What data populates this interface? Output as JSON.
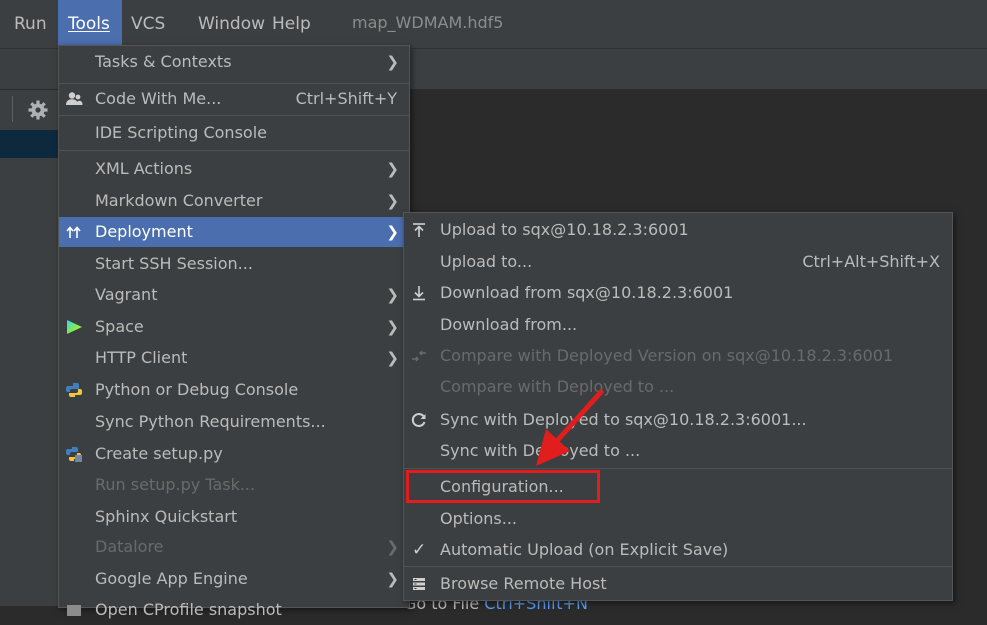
{
  "menubar": {
    "items": [
      {
        "label": "Run",
        "underline": ""
      },
      {
        "label": "Tools",
        "active": true
      },
      {
        "label": "VCS"
      },
      {
        "label": "Window"
      },
      {
        "label": "Help"
      }
    ],
    "file_title": "map_WDMAM.hdf5"
  },
  "tools_menu": {
    "items": [
      {
        "label": "Tasks & Contexts",
        "submenu": true
      },
      {
        "label": "Code With Me...",
        "shortcut": "Ctrl+Shift+Y",
        "icon": "code-with-me-icon"
      },
      {
        "label": "IDE Scripting Console"
      },
      {
        "label": "XML Actions",
        "submenu": true
      },
      {
        "label": "Markdown Converter",
        "submenu": true
      },
      {
        "label": "Deployment",
        "submenu": true,
        "icon": "deployment-icon",
        "highlighted": true
      },
      {
        "label": "Start SSH Session..."
      },
      {
        "label": "Vagrant",
        "submenu": true
      },
      {
        "label": "Space",
        "submenu": true,
        "icon": "space-icon"
      },
      {
        "label": "HTTP Client",
        "submenu": true
      },
      {
        "label": "Python or Debug Console",
        "icon": "python-icon"
      },
      {
        "label": "Sync Python Requirements..."
      },
      {
        "label": "Create setup.py",
        "icon": "python-setup-icon"
      },
      {
        "label": "Run setup.py Task...",
        "disabled": true
      },
      {
        "label": "Sphinx Quickstart"
      },
      {
        "label": "Datalore",
        "disabled": true,
        "submenu": true
      },
      {
        "label": "Google App Engine",
        "submenu": true
      },
      {
        "label": "Open CProfile snapshot"
      }
    ]
  },
  "deployment_menu": {
    "items": [
      {
        "label": "Upload to sqx@10.18.2.3:6001",
        "icon": "upload-icon"
      },
      {
        "label": "Upload to...",
        "shortcut": "Ctrl+Alt+Shift+X"
      },
      {
        "label": "Download from sqx@10.18.2.3:6001",
        "icon": "download-icon"
      },
      {
        "label": "Download from..."
      },
      {
        "label": "Compare with Deployed Version on sqx@10.18.2.3:6001",
        "disabled": true,
        "icon": "compare-icon"
      },
      {
        "label": "Compare with Deployed to ...",
        "disabled": true
      },
      {
        "label": "Sync with Deployed to sqx@10.18.2.3:6001...",
        "icon": "sync-icon"
      },
      {
        "label": "Sync with Deployed to ..."
      },
      {
        "label": "Configuration..."
      },
      {
        "label": "Options..."
      },
      {
        "label": "Automatic Upload (on Explicit Save)",
        "checked": true
      },
      {
        "label": "Browse Remote Host",
        "icon": "browse-remote-host-icon"
      }
    ]
  },
  "background": {
    "text": "Go to File",
    "shortcut_link": "Ctrl+Shift+N"
  },
  "colors": {
    "highlight": "#4b6eaf",
    "annotation_red": "#e11d1d"
  }
}
